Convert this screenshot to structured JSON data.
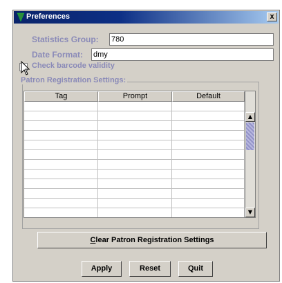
{
  "window": {
    "title": "Preferences",
    "close_label": "x"
  },
  "form": {
    "statistics_group_label": "Statistics Group:",
    "statistics_group_value": "780",
    "date_format_label": "Date Format:",
    "date_format_value": "dmy",
    "barcode_check_label": "Check barcode validity",
    "barcode_check_checked": false
  },
  "patron_registration": {
    "group_label": "Patron Registration Settings:",
    "columns": [
      "Tag",
      "Prompt",
      "Default"
    ],
    "rows": 12,
    "clear_button_prefix": "C",
    "clear_button_rest": "lear Patron Registration Settings"
  },
  "buttons": {
    "apply": "Apply",
    "reset": "Reset",
    "quit": "Quit"
  },
  "colors": {
    "title_bar": "#0a246a",
    "label": "#8a8ab8",
    "face": "#d4d0c8"
  }
}
